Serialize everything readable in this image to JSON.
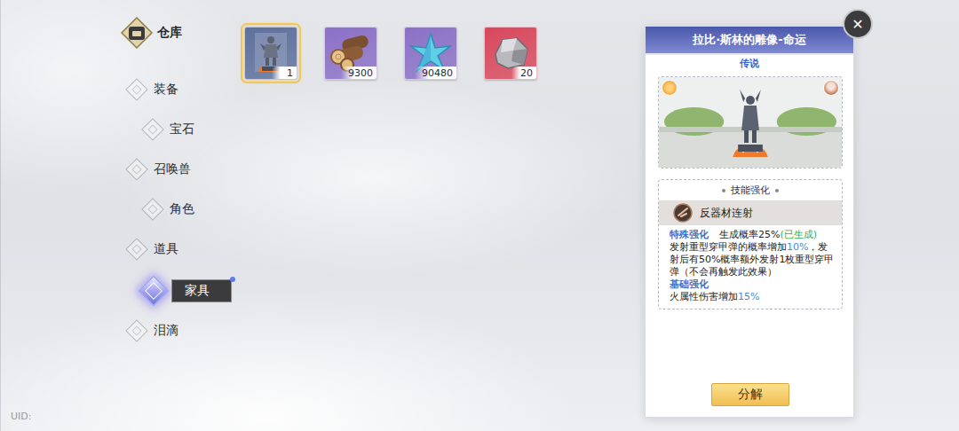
{
  "header": {
    "title": "仓库"
  },
  "sidebar": {
    "items": [
      {
        "label": "装备",
        "selected": false
      },
      {
        "label": "宝石",
        "selected": false
      },
      {
        "label": "召唤兽",
        "selected": false
      },
      {
        "label": "角色",
        "selected": false
      },
      {
        "label": "道具",
        "selected": false
      },
      {
        "label": "家具",
        "selected": true
      },
      {
        "label": "泪滴",
        "selected": false
      }
    ]
  },
  "items": [
    {
      "kind": "statue",
      "count": "1",
      "selected": true,
      "color": "#5d6f9c"
    },
    {
      "kind": "wood",
      "count": "9300",
      "selected": false,
      "color": "#8b70c6"
    },
    {
      "kind": "crystal",
      "count": "90480",
      "selected": false,
      "color": "#8b70c6"
    },
    {
      "kind": "ore",
      "count": "20",
      "selected": false,
      "color": "#d9475c"
    }
  ],
  "detail": {
    "title": "拉比·斯林的雕像-命运",
    "rarity": "传说",
    "section": "技能强化",
    "skill": "反器材连射",
    "special": {
      "label": "特殊强化",
      "chance": "生成概率25%",
      "status": "(已生成)",
      "text": [
        {
          "text": "发射重型穿甲弹的概率增加",
          "highlight": false
        },
        {
          "text": "10%",
          "highlight": true
        },
        {
          "text": "，发射后有50%概率额外发射1枚重型穿甲弹（不会再触发此效果）",
          "highlight": false
        }
      ]
    },
    "basic": {
      "label": "基础强化",
      "text": [
        {
          "text": "火属性伤害增加",
          "highlight": false
        },
        {
          "text": "15%",
          "highlight": true
        }
      ]
    },
    "button": "分解",
    "close": "✕"
  },
  "footer": {
    "uid": "UID:"
  }
}
